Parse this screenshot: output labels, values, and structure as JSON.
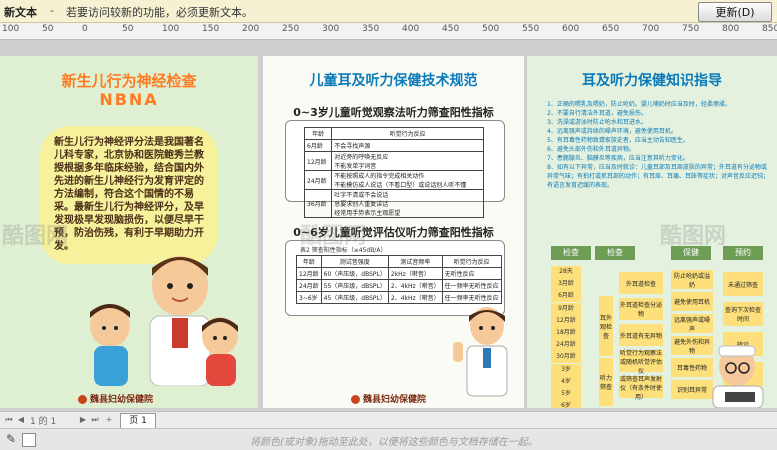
{
  "infobar": {
    "title": "新文本",
    "separator": "-",
    "message": "若要访问较新的功能，必须更新文本。",
    "update_button": "更新(D)"
  },
  "ruler": {
    "ticks": [
      "100",
      "50",
      "0",
      "50",
      "100",
      "150",
      "200",
      "250",
      "300",
      "350",
      "400",
      "450",
      "500",
      "550",
      "600",
      "650",
      "700",
      "750",
      "800",
      "850"
    ]
  },
  "panel1": {
    "title_line1": "新生儿行为神经检查",
    "title_line2": "NBNA",
    "body": "新生儿行为神经评分法是我国著名儿科专家，北京协和医院鲍秀兰教授根据多年临床经验，结合国内外先进的新生儿神经行为发育评定的方法编制，符合这个国情的不易采。最新生儿行为神经评分，及早发现极早发现脑损伤，以便尽早干预，防治伤残，有利于早期助力开发。",
    "logo": "魏县妇幼保健院"
  },
  "panel2": {
    "title": "儿童耳及听力保健技术规范",
    "subtitle1": "0~3岁儿童听觉观察法听力筛查阳性指标",
    "table1": {
      "headers": [
        "年龄",
        "听觉行为反应"
      ],
      "rows": [
        [
          "6月龄",
          "不会寻找声源"
        ],
        [
          "12月龄",
          "对近旁的呼唤无反应\n不能发单字词音"
        ],
        [
          "24月龄",
          "不能按照成人的指令完成相关动作\n不能模仿成人说话（不看口型）或说话别人听不懂"
        ],
        [
          "36月龄",
          "吐字不清或不会说话\n总要求别人重复讲话\n经常用手势表示主观愿望"
        ]
      ]
    },
    "subtitle2": "0~6岁儿童听觉评估仪听力筛查阳性指标",
    "table2": {
      "caption": "表2 筛查阳性指标（≥45dB/A）",
      "headers": [
        "年龄",
        "测试音强度",
        "测试音频率",
        "听觉行为反应"
      ],
      "rows": [
        [
          "12月龄",
          "60（声压级，dBSPL）",
          "2kHz（啭音）",
          "无听性反应"
        ],
        [
          "24月龄",
          "55（声压级，dBSPL）",
          "2、4kHz（啭音）",
          "任一频率无听性反应"
        ],
        [
          "3~6岁",
          "45（声压级，dBSPL）",
          "2、4kHz（啭音）",
          "任一频率无听性反应"
        ]
      ]
    },
    "logo": "魏县妇幼保健院"
  },
  "panel3": {
    "title": "耳及听力保健知识指导",
    "tips": [
      "1、正确的喂乳及喂奶，防止呛奶。婴儿哺奶时应当及时，轻柔擦揉。",
      "2、不要自行清洁外耳道，避免损伤。",
      "3、洗澡或游泳时防止呛水和耳进水。",
      "4、远离强声或持续的噪声环境，避免使用耳机。",
      "5、有耳毒性药物致聋家族史者，应当主动告知医生。",
      "6、避免头部外伤和外耳道异物。",
      "7、患腮腺炎、脑膜炎等疾病，应当注意其听力变化。",
      "8、如有以下异常，应当及时就诊：儿童耳部及耳周皮肤的异常；外耳道有分泌物或异常气味；有拍打或抓耳部的动作；有耳痒、耳痛、耳胀等症状；对声音反应迟钝；有语言发育迟缓的表现。"
    ],
    "headers": [
      "检查",
      "检查",
      "保健",
      "预约"
    ],
    "ages": [
      "28天",
      "3月龄",
      "6月龄",
      "9月龄",
      "12月龄",
      "18月龄",
      "24月龄",
      "30月龄",
      "3岁",
      "4岁",
      "5岁",
      "6岁"
    ],
    "col1": [
      "耳外观检查"
    ],
    "col2": [
      "外耳道检查",
      "外耳道检查分泌物",
      "外耳道有无异物",
      "听觉行为观察法或随机听觉评估仪",
      "或筛查耳声发射仪（有条件时使用）"
    ],
    "col2b": [
      "听力筛查"
    ],
    "col3": [
      "防止呛奶或溢奶",
      "避免使用耳机",
      "远离强声或噪声",
      "避免外伤和异物",
      "耳毒性药物",
      "识别耳异常"
    ],
    "col4": [
      "未通过筛查",
      "查询下次检查时间",
      "转诊",
      "随访"
    ]
  },
  "watermark": "酷图网",
  "bottom": {
    "page_indicator": "1 的 1",
    "page_tab": "页 1",
    "status_hint": "将颜色(或对象)拖动至此处，以便将这些颜色与文档存储在一起。"
  },
  "colors": {
    "accent_orange": "#ff7a20",
    "accent_blue": "#0a7ab8",
    "panel_green": "#dff0d2",
    "table_header_green": "#6e9d56"
  }
}
